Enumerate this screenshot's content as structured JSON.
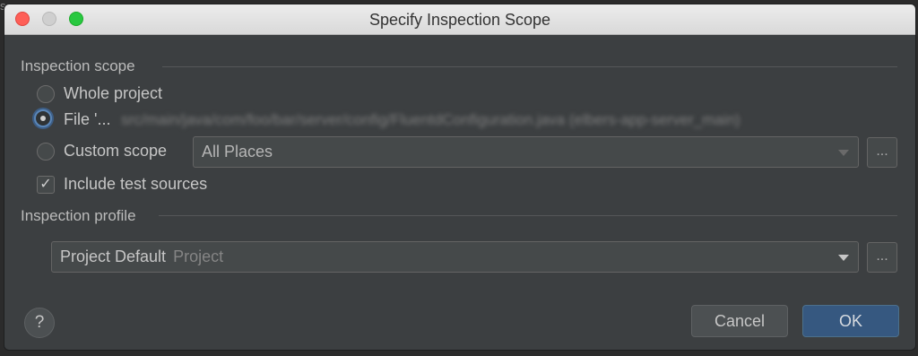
{
  "window": {
    "title": "Specify Inspection Scope"
  },
  "background_peek": "sec",
  "scope": {
    "section_label": "Inspection scope",
    "options": [
      {
        "label": "Whole project",
        "selected": false
      },
      {
        "label": "File '...",
        "selected": true
      },
      {
        "label": "Custom scope",
        "selected": false
      }
    ],
    "file_path_obscured": "src/main/java/com/foo/bar/server/config/FluentdConfiguration.java (elbers-app-server_main)",
    "custom_scope_value": "All Places",
    "include_tests_label": "Include test sources",
    "include_tests_checked": true
  },
  "profile": {
    "section_label": "Inspection profile",
    "selected_name": "Project Default",
    "selected_type": "Project"
  },
  "buttons": {
    "browse_label": "...",
    "help_label": "?",
    "cancel_label": "Cancel",
    "ok_label": "OK"
  },
  "colors": {
    "background": "#3c3f41",
    "accent": "#365880",
    "text": "#c6c6c6"
  }
}
